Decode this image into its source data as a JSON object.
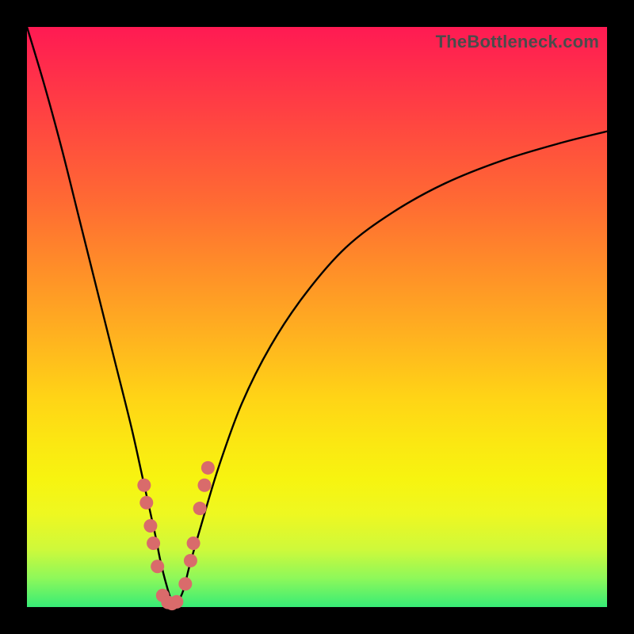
{
  "attribution": "TheBottleneck.com",
  "chart_data": {
    "type": "line",
    "title": "",
    "xlabel": "",
    "ylabel": "",
    "xlim": [
      0,
      100
    ],
    "ylim": [
      0,
      100
    ],
    "series": [
      {
        "name": "bottleneck-curve",
        "x": [
          0,
          3,
          6,
          9,
          12,
          15,
          18,
          20,
          22,
          23,
          24,
          25,
          26,
          27,
          28,
          30,
          33,
          37,
          42,
          48,
          55,
          63,
          72,
          82,
          92,
          100
        ],
        "values": [
          100,
          90,
          79,
          67,
          55,
          43,
          31,
          22,
          13,
          8,
          4,
          1,
          1,
          3,
          7,
          14,
          24,
          35,
          45,
          54,
          62,
          68,
          73,
          77,
          80,
          82
        ]
      }
    ],
    "markers": [
      {
        "name": "left-markers",
        "x": [
          20.2,
          20.6,
          21.3,
          21.8,
          22.5,
          23.4
        ],
        "values": [
          21,
          18,
          14,
          11,
          7,
          2
        ]
      },
      {
        "name": "right-markers",
        "x": [
          27.3,
          28.2,
          28.7,
          29.8,
          30.6,
          31.2
        ],
        "values": [
          4,
          8,
          11,
          17,
          21,
          24
        ]
      },
      {
        "name": "bottom-markers",
        "x": [
          24.3,
          25.0,
          25.8
        ],
        "values": [
          0.8,
          0.6,
          0.9
        ]
      }
    ],
    "marker_color": "#d96b6b",
    "curve_color": "#000000"
  }
}
